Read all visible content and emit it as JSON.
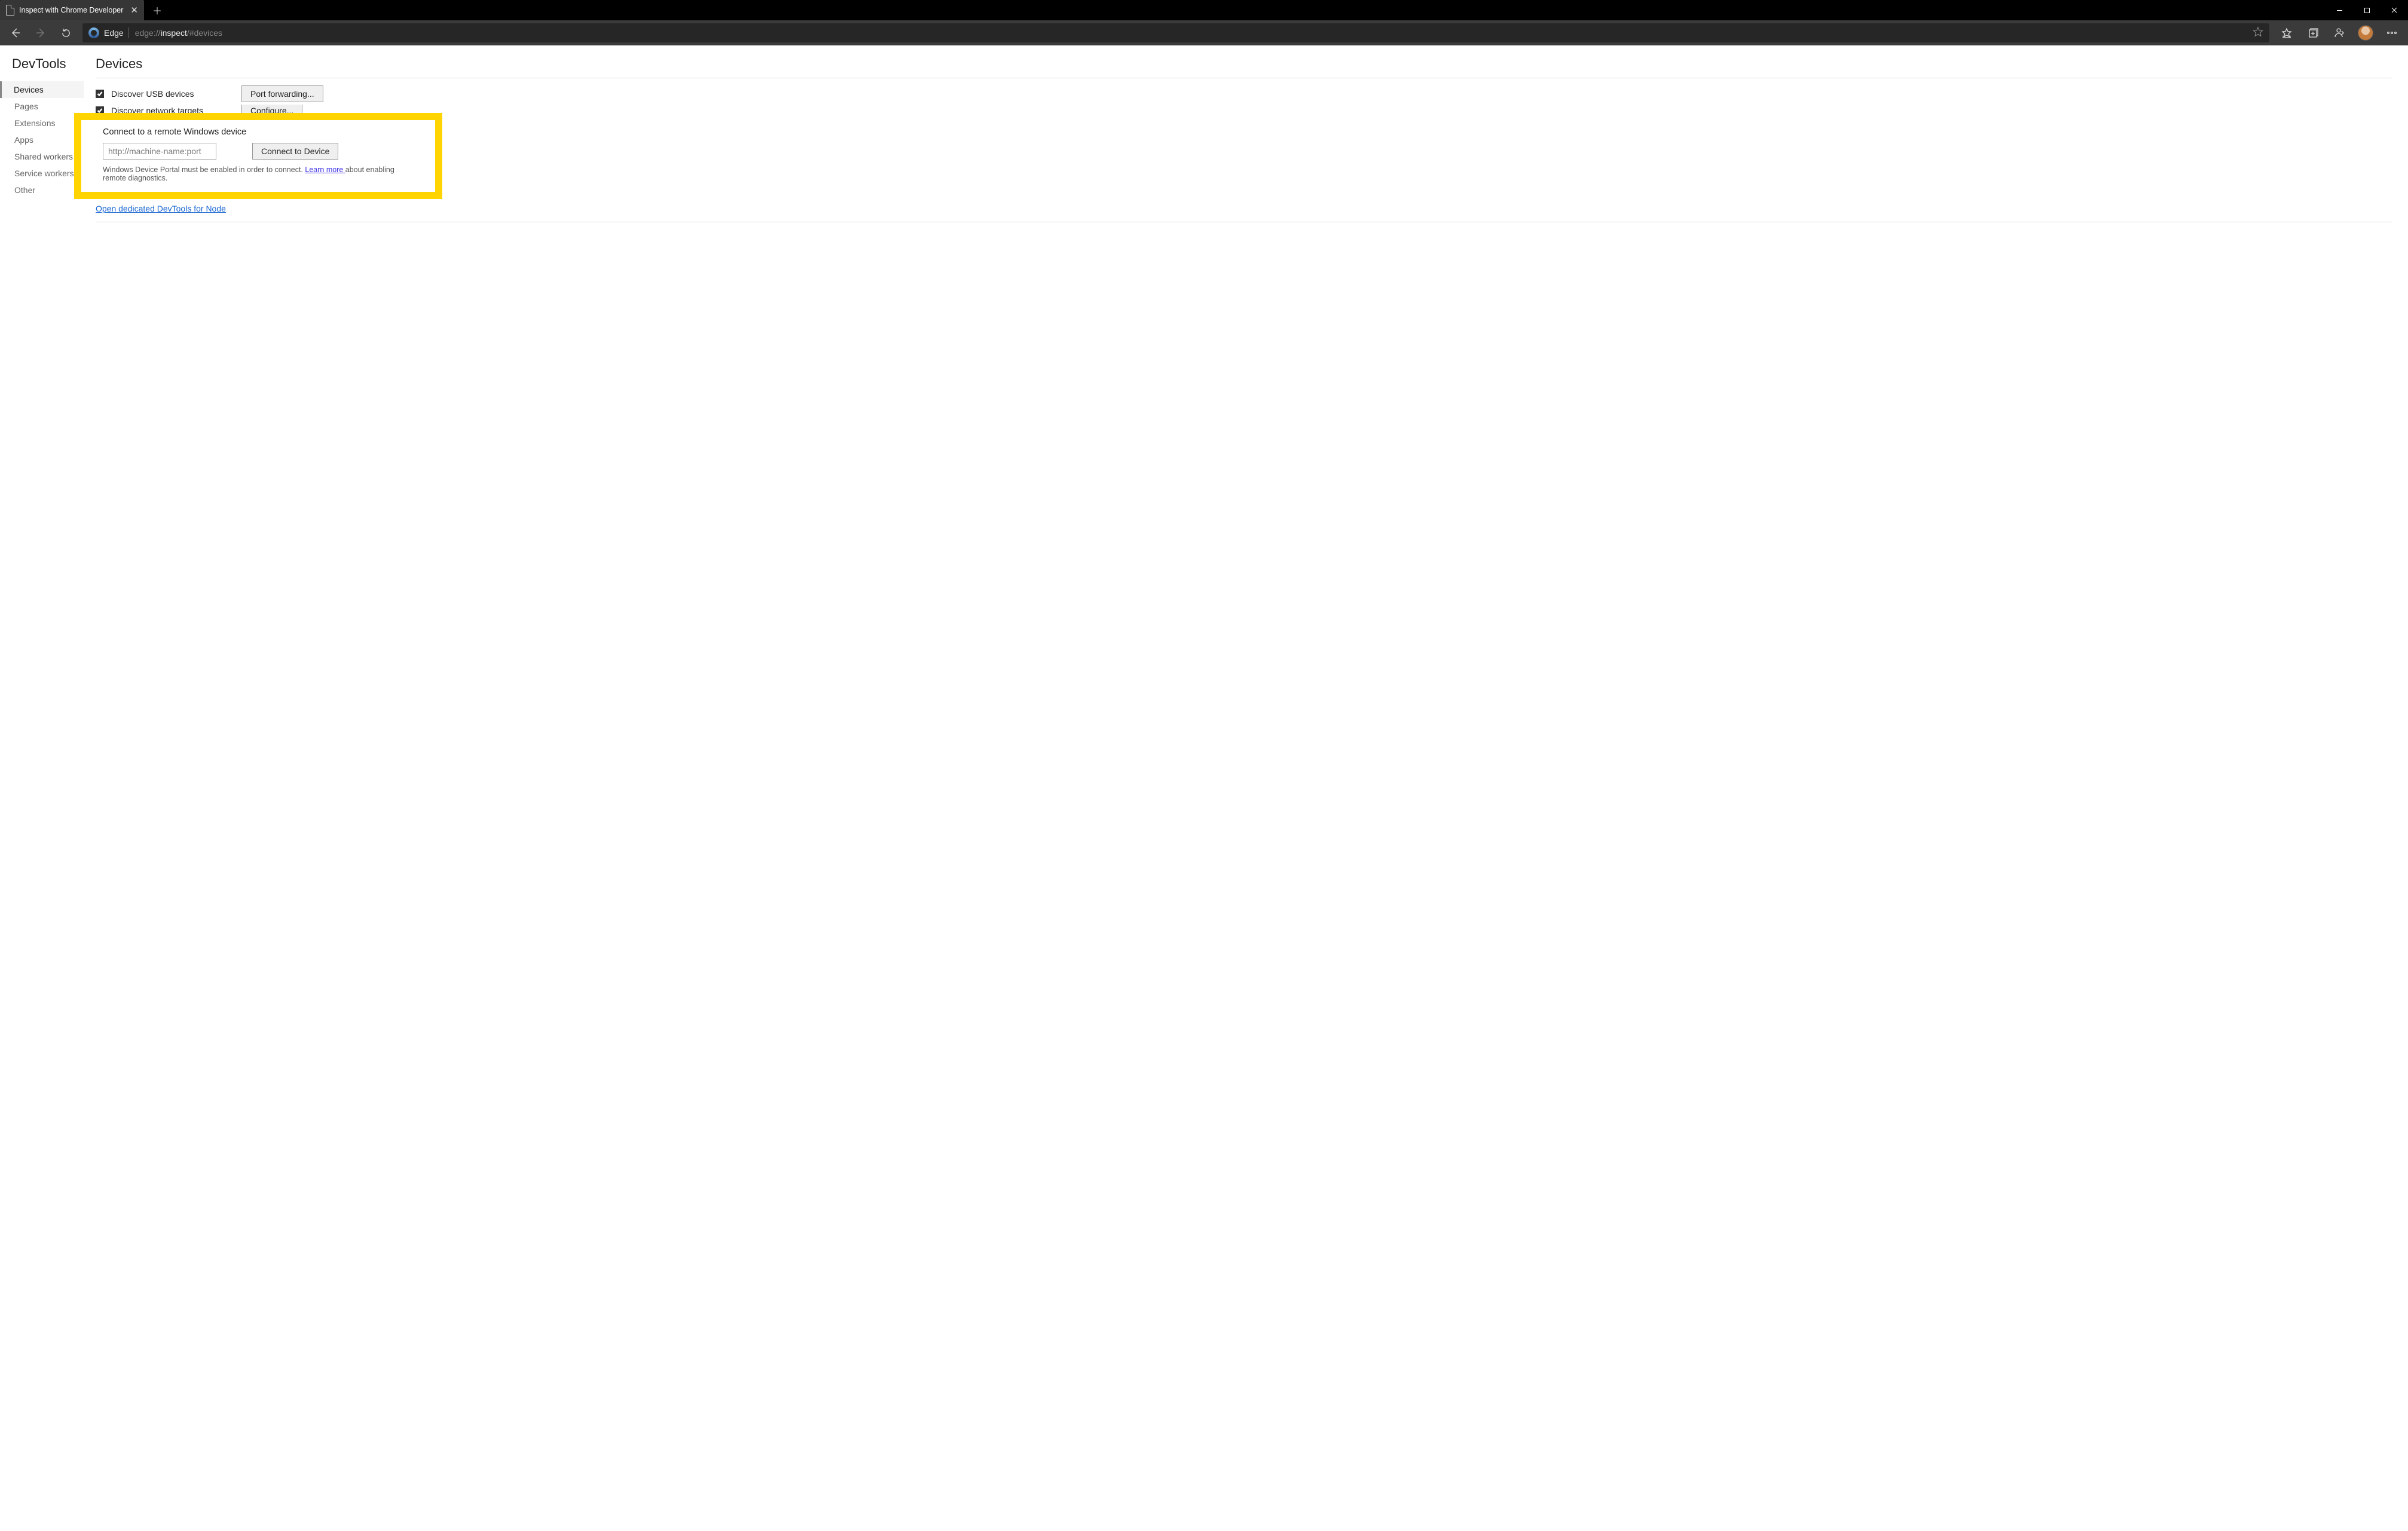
{
  "tab": {
    "title": "Inspect with Chrome Developer"
  },
  "addr": {
    "engine": "Edge",
    "url_dim_prefix": "edge://",
    "url_strong": "inspect",
    "url_dim_suffix": "/#devices"
  },
  "sidebar": {
    "title": "DevTools",
    "items": [
      "Devices",
      "Pages",
      "Extensions",
      "Apps",
      "Shared workers",
      "Service workers",
      "Other"
    ]
  },
  "main": {
    "title": "Devices",
    "usb_label": "Discover USB devices",
    "portfwd_btn": "Port forwarding...",
    "net_label": "Discover network targets",
    "configure_btn": "Configure...",
    "remote": {
      "title": "Connect to a remote Windows device",
      "placeholder": "http://machine-name:port",
      "connect_btn": "Connect to Device",
      "hint_pre": "Windows Device Portal must be enabled in order to connect. ",
      "hint_link": "Learn more ",
      "hint_post": "about enabling remote diagnostics."
    },
    "node_link": "Open dedicated DevTools for Node"
  }
}
